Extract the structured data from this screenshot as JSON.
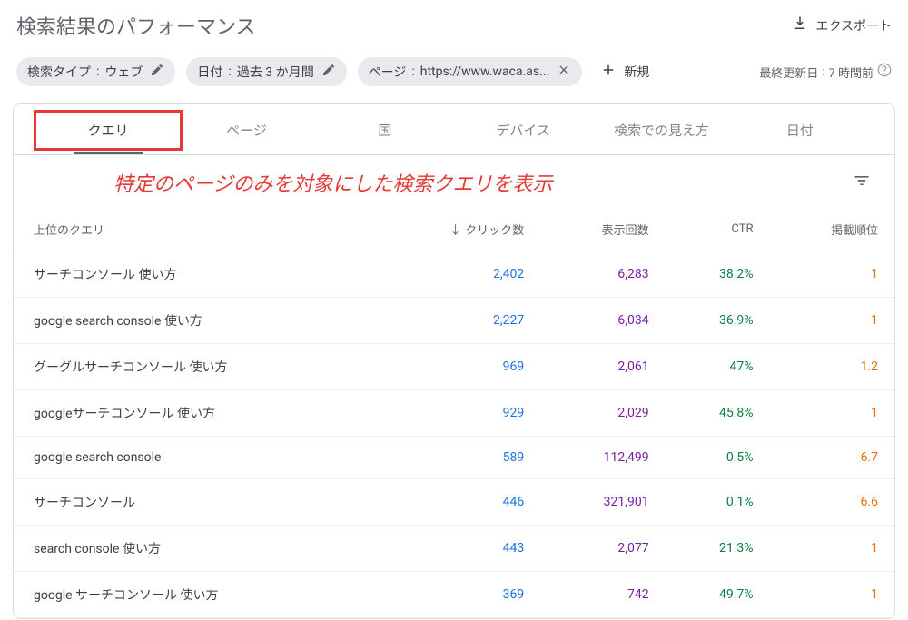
{
  "header": {
    "title": "検索結果のパフォーマンス",
    "export_label": "エクスポート"
  },
  "filters": {
    "search_type_label": "検索タイプ",
    "search_type_value": "ウェブ",
    "date_label": "日付",
    "date_value": "過去 3 か月間",
    "page_label": "ページ",
    "page_value": "https://www.waca.as...",
    "new_label": "新規",
    "last_updated_label": "最終更新日",
    "last_updated_value": "7 時間前"
  },
  "tabs": [
    "クエリ",
    "ページ",
    "国",
    "デバイス",
    "検索での見え方",
    "日付"
  ],
  "annotation": "特定のページのみを対象にした検索クエリを表示",
  "table": {
    "columns": {
      "query": "上位のクエリ",
      "clicks": "クリック数",
      "impressions": "表示回数",
      "ctr": "CTR",
      "position": "掲載順位"
    },
    "rows": [
      {
        "query": "サーチコンソール 使い方",
        "clicks": "2,402",
        "impressions": "6,283",
        "ctr": "38.2%",
        "position": "1"
      },
      {
        "query": "google search console 使い方",
        "clicks": "2,227",
        "impressions": "6,034",
        "ctr": "36.9%",
        "position": "1"
      },
      {
        "query": "グーグルサーチコンソール 使い方",
        "clicks": "969",
        "impressions": "2,061",
        "ctr": "47%",
        "position": "1.2"
      },
      {
        "query": "googleサーチコンソール 使い方",
        "clicks": "929",
        "impressions": "2,029",
        "ctr": "45.8%",
        "position": "1"
      },
      {
        "query": "google search console",
        "clicks": "589",
        "impressions": "112,499",
        "ctr": "0.5%",
        "position": "6.7"
      },
      {
        "query": "サーチコンソール",
        "clicks": "446",
        "impressions": "321,901",
        "ctr": "0.1%",
        "position": "6.6"
      },
      {
        "query": "search console 使い方",
        "clicks": "443",
        "impressions": "2,077",
        "ctr": "21.3%",
        "position": "1"
      },
      {
        "query": "google サーチコンソール 使い方",
        "clicks": "369",
        "impressions": "742",
        "ctr": "49.7%",
        "position": "1"
      }
    ]
  }
}
